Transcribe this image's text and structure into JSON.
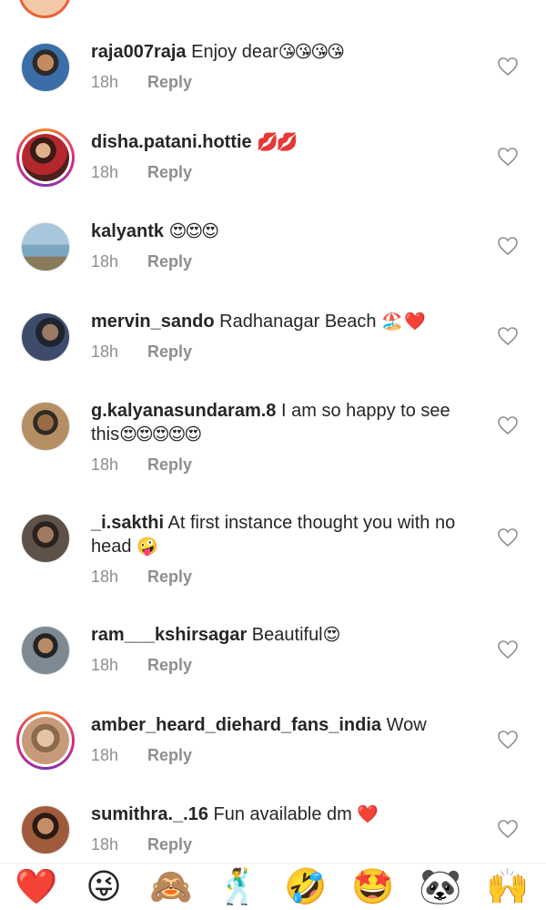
{
  "comments": [
    {
      "username": "raja007raja",
      "text": "Enjoy dear",
      "emoji": "😘😘😘😘",
      "time": "18h",
      "reply": "Reply",
      "ring": false,
      "avatar_color": "#3b6ea8"
    },
    {
      "username": "disha.patani.hottie",
      "text": "",
      "emoji": "💋💋",
      "time": "18h",
      "reply": "Reply",
      "ring": true,
      "avatar_color": "#b3272d"
    },
    {
      "username": "kalyantk",
      "text": "",
      "emoji": "😍😍😍",
      "time": "18h",
      "reply": "Reply",
      "ring": false,
      "avatar_color": "#7aa6c2"
    },
    {
      "username": "mervin_sando",
      "text": "Radhanagar Beach",
      "emoji": "🏖️ ❤️",
      "time": "18h",
      "reply": "Reply",
      "ring": false,
      "avatar_color": "#3d4c6b"
    },
    {
      "username": "g.kalyanasundaram.8",
      "text": "I am so happy to see this",
      "emoji": "😍😍😍😍😍",
      "time": "18h",
      "reply": "Reply",
      "ring": false,
      "avatar_color": "#b58f63"
    },
    {
      "username": "_i.sakthi",
      "text": "At first instance thought you with no head",
      "emoji": "🤪",
      "time": "18h",
      "reply": "Reply",
      "ring": false,
      "avatar_color": "#5e5148"
    },
    {
      "username": "ram___kshirsagar",
      "text": "Beautiful",
      "emoji": "😍",
      "time": "18h",
      "reply": "Reply",
      "ring": false,
      "avatar_color": "#7d8a94"
    },
    {
      "username": "amber_heard_diehard_fans_india",
      "text": "Wow",
      "emoji": "",
      "time": "18h",
      "reply": "Reply",
      "ring": true,
      "avatar_color": "#c79b7a"
    },
    {
      "username": "sumithra._.16",
      "text": "Fun available dm",
      "emoji": "❤️",
      "time": "18h",
      "reply": "Reply",
      "ring": false,
      "avatar_color": "#a05a3c"
    }
  ],
  "reactions": [
    {
      "emoji": "❤️",
      "name": "heart"
    },
    {
      "emoji": "😜",
      "name": "winking-tongue"
    },
    {
      "emoji": "🙈",
      "name": "see-no-evil-monkey"
    },
    {
      "emoji": "🕺",
      "name": "dancer"
    },
    {
      "emoji": "🤣",
      "name": "rolling-laughing"
    },
    {
      "emoji": "🤩",
      "name": "star-struck"
    },
    {
      "emoji": "🐼",
      "name": "panda"
    },
    {
      "emoji": "🙌",
      "name": "raised-hands"
    }
  ],
  "icons": {
    "like": "heart-outline-icon"
  },
  "colors": {
    "text": "#262626",
    "meta": "#8e8e8e",
    "heart_outline": "#8e8e8e",
    "story_ring": "#dd2a7b"
  }
}
